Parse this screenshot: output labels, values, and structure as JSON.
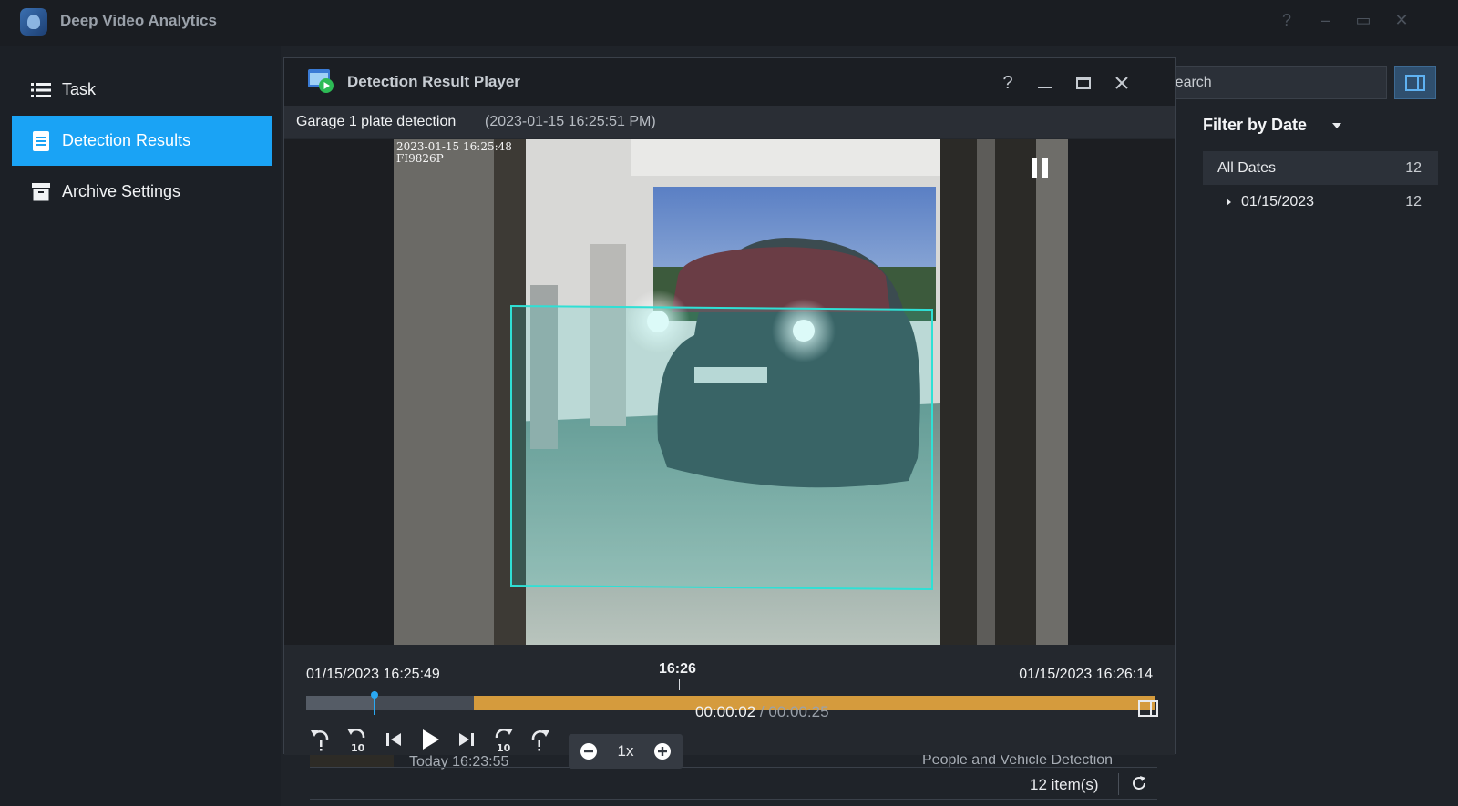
{
  "app": {
    "title": "Deep Video Analytics",
    "window_controls": [
      "?",
      "–",
      "▭",
      "✕"
    ]
  },
  "sidebar": {
    "items": [
      {
        "label": "Task",
        "icon": "list-icon",
        "active": false
      },
      {
        "label": "Detection Results",
        "icon": "document-icon",
        "active": true
      },
      {
        "label": "Archive Settings",
        "icon": "archive-icon",
        "active": false
      }
    ]
  },
  "right_panel": {
    "search_placeholder": "Search",
    "filter_title": "Filter by Date",
    "dates": [
      {
        "label": "All Dates",
        "count": "12"
      },
      {
        "label": "01/15/2023",
        "count": "12"
      }
    ]
  },
  "list_footer": {
    "row_time": "Today 16:23:55",
    "row_type": "People and Vehicle Detection",
    "item_count": "12 item(s)"
  },
  "player": {
    "title": "Detection Result Player",
    "task_name": "Garage 1 plate detection",
    "event_time": "(2023-01-15 16:25:51 PM)",
    "osd_text": "2023-01-15 16:25:48\nFI9826P",
    "timeline": {
      "start": "01/15/2023 16:25:49",
      "end": "01/15/2023 16:26:14",
      "mid_label": "16:26",
      "played_fraction": 0.079,
      "event_start_fraction": 0.198
    },
    "speed": "1x",
    "time_current": "00:00:02",
    "time_separator": "/",
    "time_total": "00:00:25"
  },
  "colors": {
    "accent": "#1aa3f5",
    "detection_box": "#2fe0d5",
    "event_segment": "#d59b3d"
  }
}
